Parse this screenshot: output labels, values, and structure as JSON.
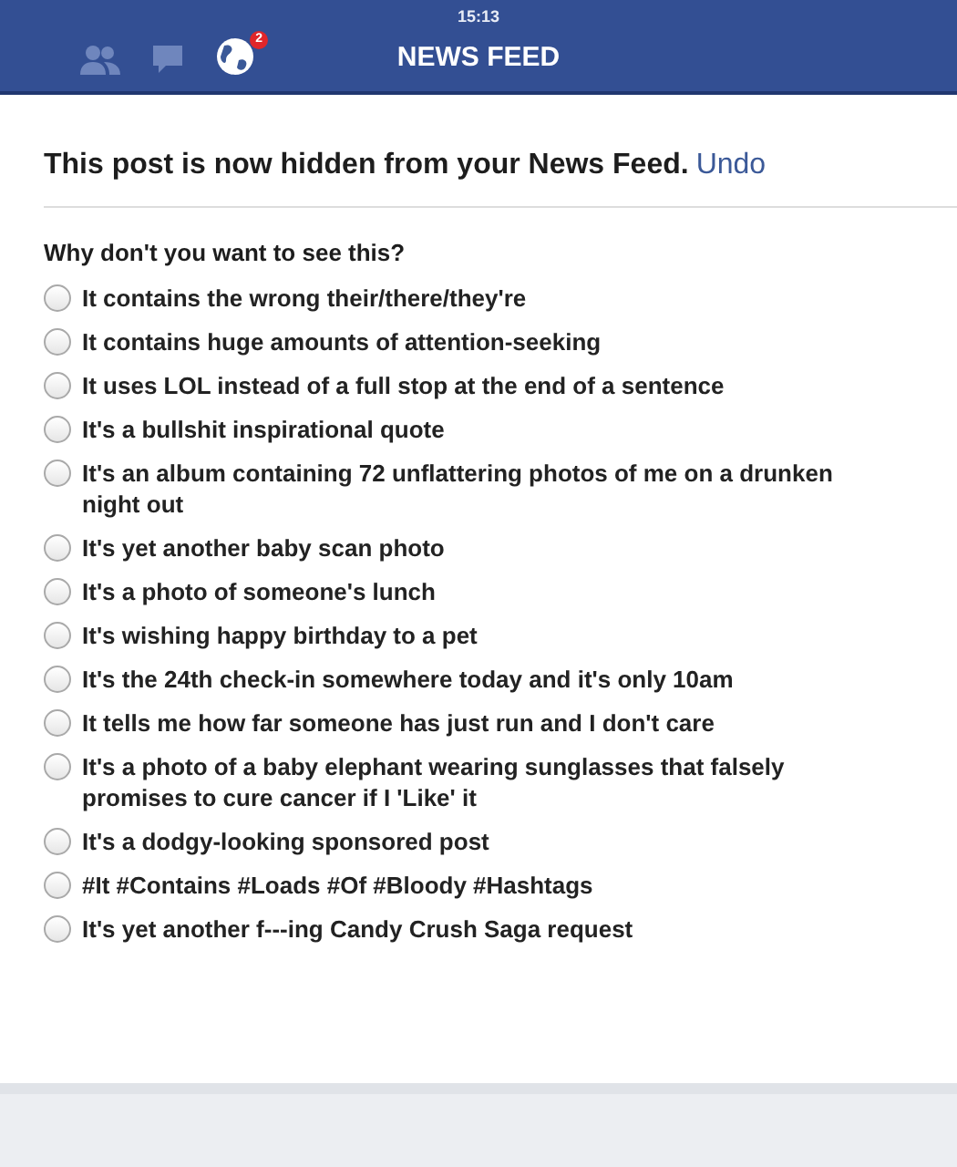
{
  "status_bar": {
    "time": "15:13"
  },
  "nav": {
    "title": "NEWS FEED",
    "notification_badge": "2"
  },
  "notice": {
    "text": "This post is now hidden from your News Feed.",
    "link": "Undo"
  },
  "question": "Why don't you want to see this?",
  "options": [
    {
      "label": "It contains the wrong their/there/they're",
      "selected": false
    },
    {
      "label": "It contains huge amounts of attention-seeking",
      "selected": false
    },
    {
      "label": "It uses LOL instead of a full stop at the end of a sentence",
      "selected": false
    },
    {
      "label": "It's a bullshit inspirational quote",
      "selected": false
    },
    {
      "label": "It's an album containing 72 unflattering photos of me on a drunken night out",
      "selected": false
    },
    {
      "label": "It's yet another baby scan photo",
      "selected": false
    },
    {
      "label": "It's a photo of someone's lunch",
      "selected": false
    },
    {
      "label": "It's wishing happy birthday to a pet",
      "selected": false
    },
    {
      "label": "It's the 24th check-in somewhere today and it's only 10am",
      "selected": false
    },
    {
      "label": "It tells me how far someone has just run and I don't care",
      "selected": false
    },
    {
      "label": "It's a photo of a baby elephant wearing sunglasses that falsely promises to cure cancer if I 'Like' it",
      "selected": false
    },
    {
      "label": "It's a dodgy-looking sponsored post",
      "selected": false
    },
    {
      "label": "#It #Contains #Loads #Of #Bloody #Hashtags",
      "selected": false
    },
    {
      "label": "It's yet another f---ing Candy Crush Saga request",
      "selected": false
    }
  ]
}
